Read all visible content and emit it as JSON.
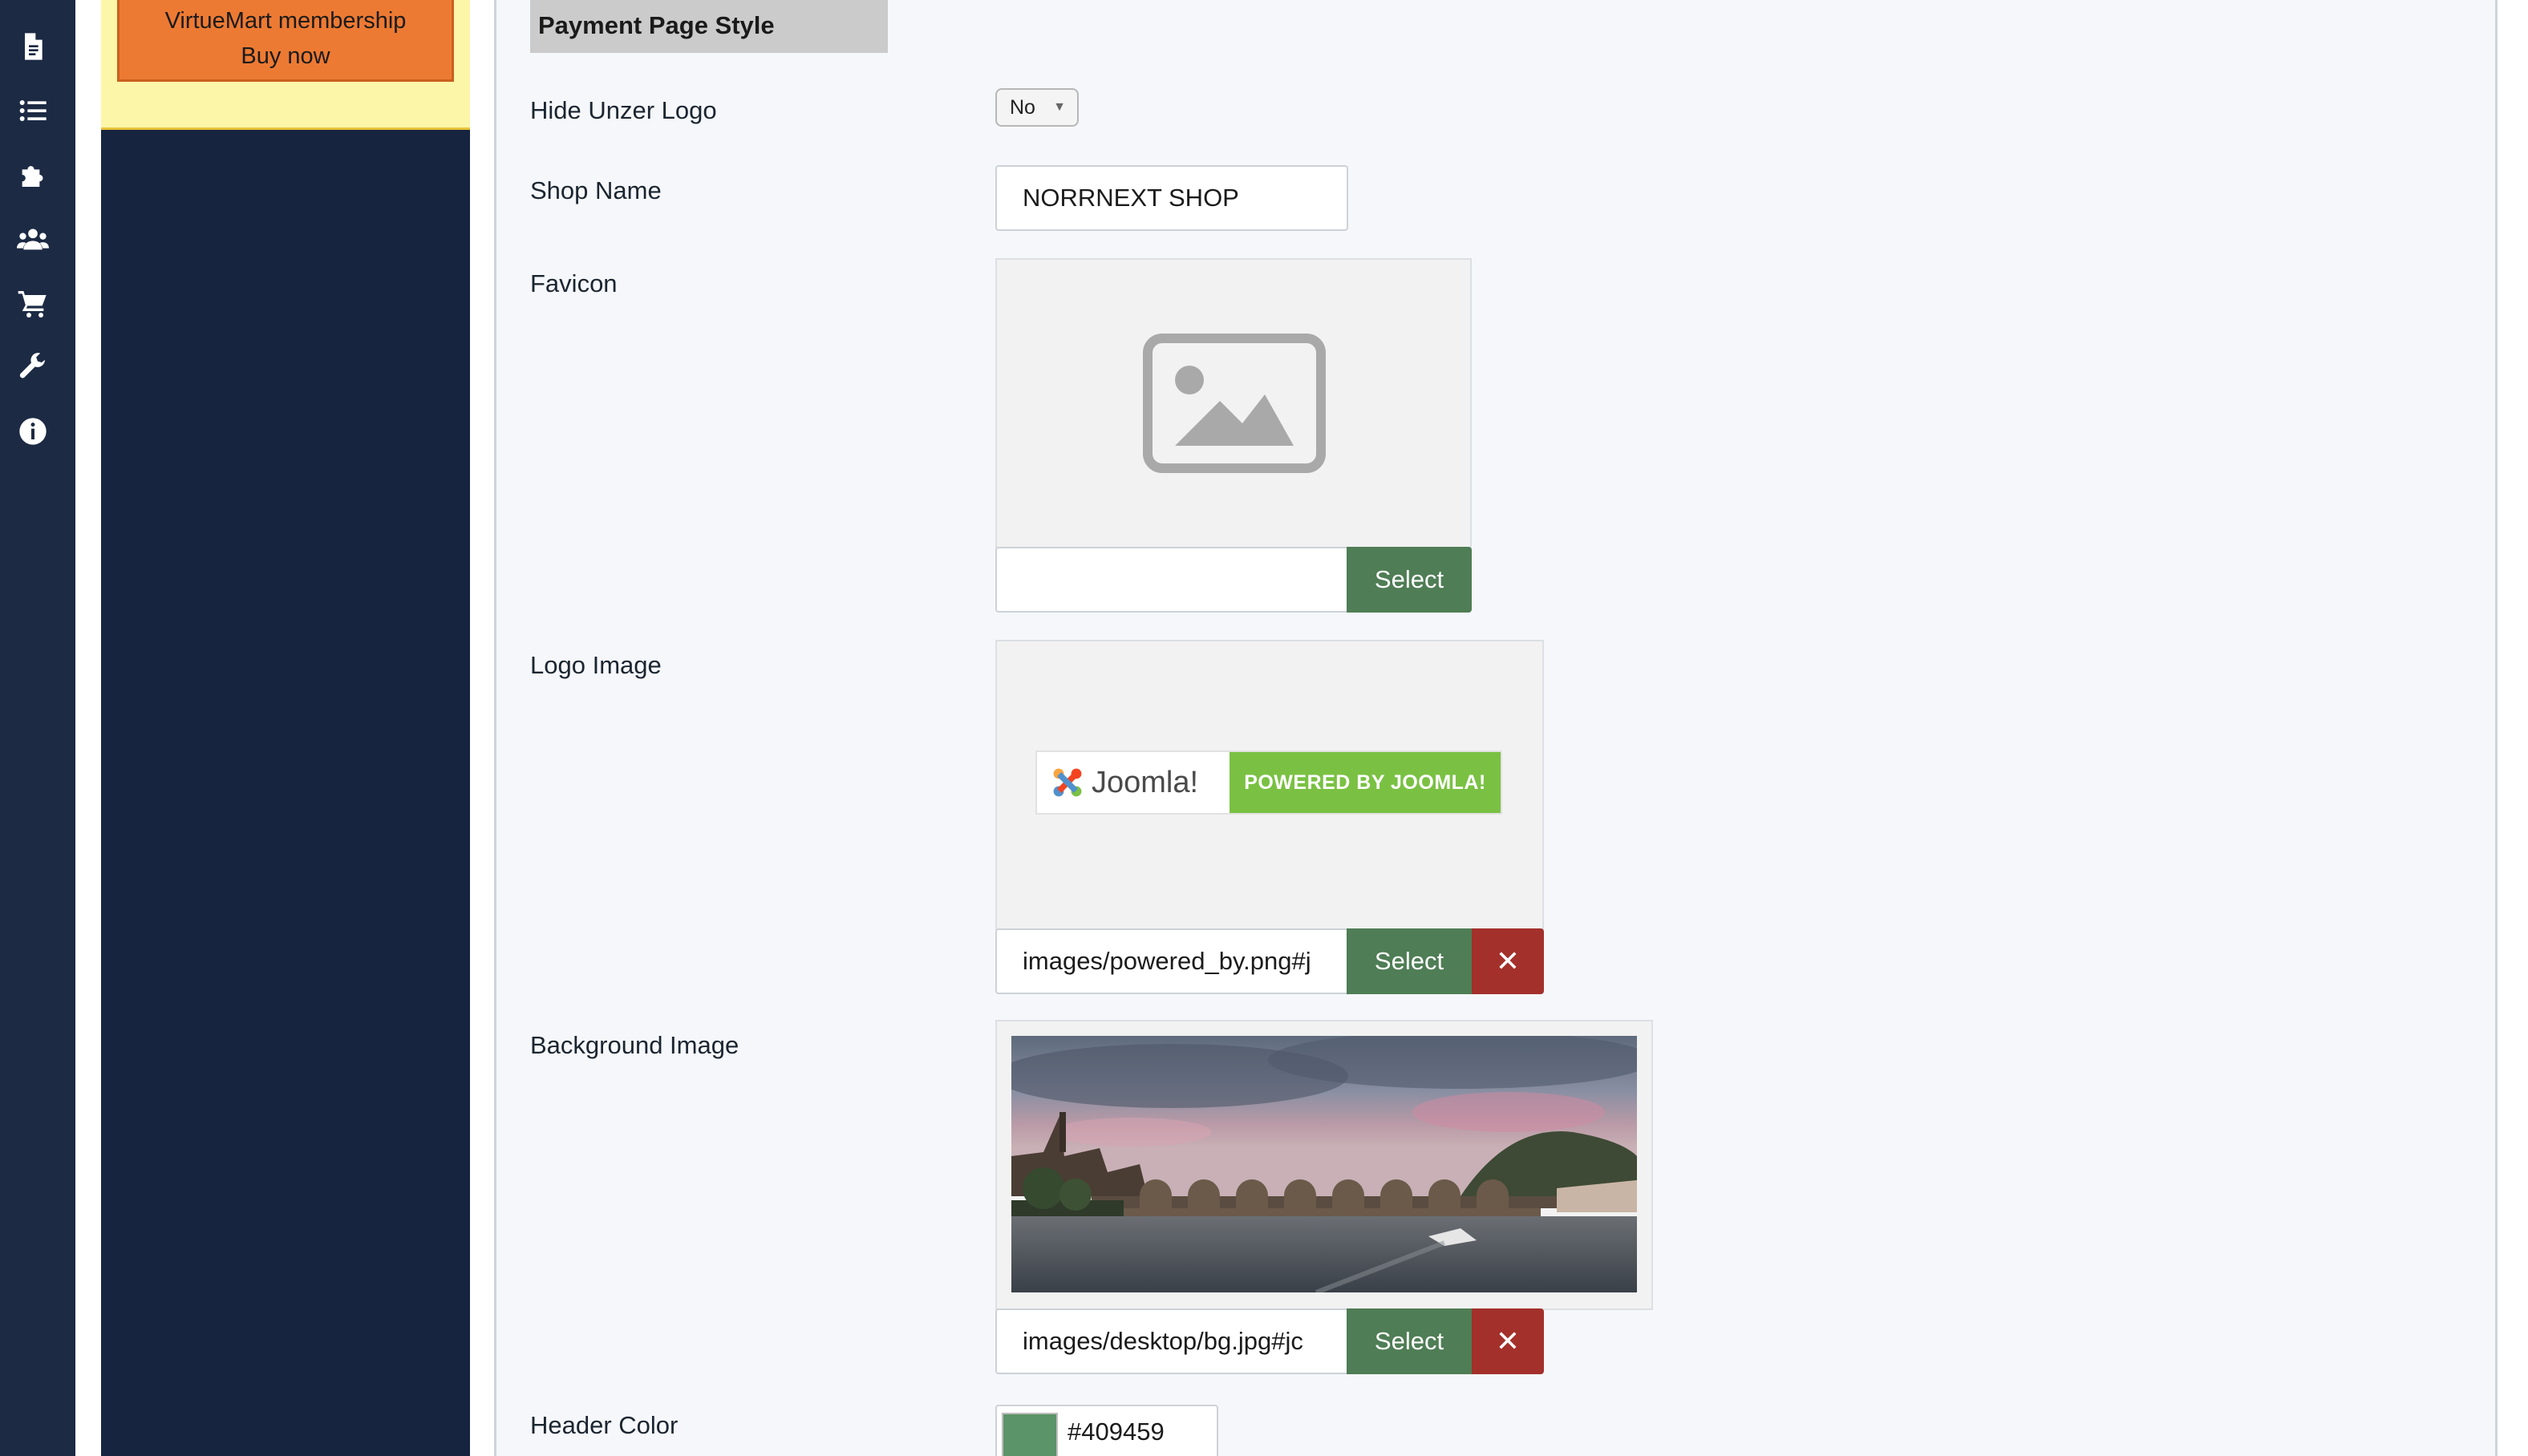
{
  "sidebar": {
    "promo": {
      "line1": "VirtueMart membership",
      "line2": "Buy now"
    },
    "rail_icons": [
      "file-icon",
      "list-icon",
      "puzzle-icon",
      "users-icon",
      "cart-icon",
      "wrench-icon",
      "info-icon"
    ]
  },
  "section": {
    "title": "Payment Page Style"
  },
  "fields": {
    "hide_logo": {
      "label": "Hide Unzer Logo",
      "value": "No"
    },
    "shop_name": {
      "label": "Shop Name",
      "value": "NORRNEXT SHOP"
    },
    "favicon": {
      "label": "Favicon",
      "value": "",
      "select_label": "Select"
    },
    "logo_image": {
      "label": "Logo Image",
      "value": "images/powered_by.png#j",
      "select_label": "Select",
      "clear_label": "✕",
      "preview_left": "Joomla!",
      "preview_right": "POWERED BY JOOMLA!"
    },
    "background_image": {
      "label": "Background Image",
      "value": "images/desktop/bg.jpg#jc",
      "select_label": "Select",
      "clear_label": "✕"
    },
    "header_color": {
      "label": "Header Color",
      "value": "#409459",
      "swatch": "#5a9468"
    }
  },
  "colors": {
    "rail_bg": "#1c2a44",
    "sidebar_bg": "#16243f",
    "promo_bg": "#fcf6a8",
    "promo_button": "#ed7a33",
    "select_button": "#4f7d55",
    "clear_button": "#a3302b"
  }
}
